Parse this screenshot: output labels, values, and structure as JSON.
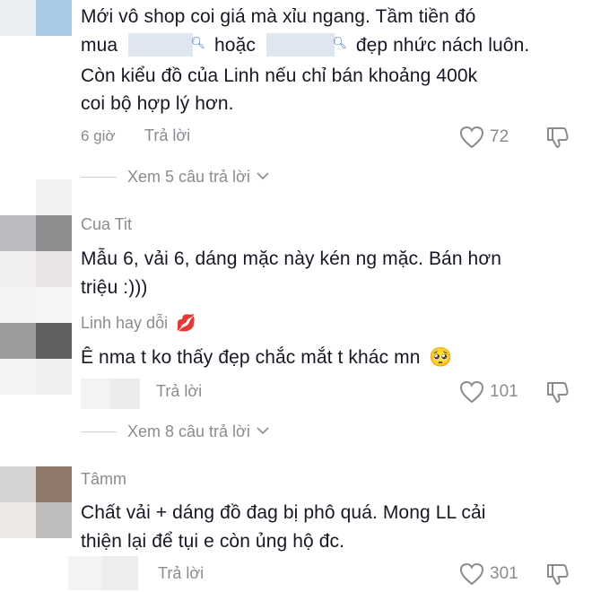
{
  "comments": [
    {
      "text_line1_a": "Mới vô shop coi giá mà xỉu ngang. Tầm tiền đó",
      "text_line2_a": "mua",
      "text_line2_b": "hoặc",
      "text_line2_c": "đẹp nhức nách luôn.",
      "text_line3": "Còn kiểu đồ của Linh nếu chỉ bán khoảng 400k",
      "text_line4": "coi bộ hợp lý hơn.",
      "time": "6 giờ",
      "reply_label": "Trả lời",
      "likes": "72",
      "view_replies": "Xem 5 câu trả lời"
    },
    {
      "username": "Cua Tit",
      "text_line1": "Mẫu 6, vải 6, dáng mặc này kén ng mặc. Bán hơn",
      "text_line2": "triệu :)))"
    },
    {
      "username": "Linh hay dỗi",
      "username_emoji": "💋",
      "text": "Ê nma t ko thấy đẹp chắc mắt t khác mn",
      "text_emoji": "🥺",
      "reply_label": "Trả lời",
      "likes": "101",
      "view_replies": "Xem 8 câu trả lời"
    },
    {
      "username": "Tâmm",
      "text_line1": "Chất vải + dáng đồ đag bị phô quá. Mong LL cải",
      "text_line2": "thiện lại để tụi e còn ủng hộ đc.",
      "reply_label": "Trả lời",
      "likes": "301"
    }
  ],
  "icons": {
    "like": "heart-outline-icon",
    "dislike": "thumbs-down-icon",
    "chevron": "chevron-down-icon",
    "search": "search-icon"
  },
  "colors": {
    "text": "#161823",
    "muted": "#8a8b91",
    "link_highlight": "#dfe6ef"
  }
}
